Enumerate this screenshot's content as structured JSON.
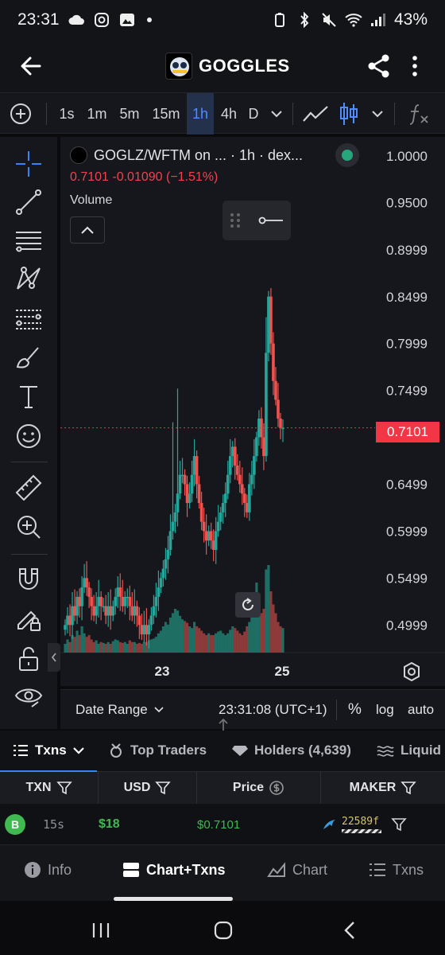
{
  "status_bar": {
    "time": "23:31",
    "battery": "43%",
    "signal_icon": "signal-bars-icon",
    "wifi_icon": "wifi-icon"
  },
  "header": {
    "title": "GOGGLES"
  },
  "toolbar": {
    "intervals": [
      "1s",
      "1m",
      "5m",
      "15m",
      "1h",
      "4h",
      "D"
    ],
    "active_interval": "1h"
  },
  "chart": {
    "legend_title": "GOGLZ/WFTM on ... · 1h · dex...",
    "legend_price": "0.7101  -0.01090 (−1.51%)",
    "volume_label": "Volume",
    "current_price_tag": "0.7101",
    "price_axis": [
      "1.0000",
      "0.9500",
      "0.8999",
      "0.8499",
      "0.7999",
      "0.7499",
      "0.6999",
      "0.6499",
      "0.5999",
      "0.5499",
      "0.4999"
    ],
    "time_axis": [
      "23",
      "25"
    ],
    "colors": {
      "up": "#26a69a",
      "down": "#ef5350",
      "price_tag": "#f23645",
      "accent": "#3b82f6"
    }
  },
  "chart_data": {
    "type": "candlestick",
    "title": "GOGLZ/WFTM on ... · 1h · dex...",
    "price_unit_ticks": [
      "0.4999",
      "0.5499",
      "0.5999",
      "0.6499",
      "0.6999",
      "0.7499",
      "0.7999",
      "0.8499",
      "0.8999",
      "0.9500",
      "1.0000"
    ],
    "ylim": [
      0.485,
      1.01
    ],
    "last_price": 0.7101,
    "change": -0.0109,
    "change_pct": -1.51,
    "closes": [
      0.5,
      0.51,
      0.5,
      0.52,
      0.51,
      0.53,
      0.52,
      0.54,
      0.55,
      0.54,
      0.53,
      0.52,
      0.51,
      0.52,
      0.53,
      0.52,
      0.52,
      0.51,
      0.52,
      0.51,
      0.52,
      0.53,
      0.54,
      0.53,
      0.52,
      0.53,
      0.53,
      0.52,
      0.51,
      0.52,
      0.51,
      0.5,
      0.49,
      0.5,
      0.49,
      0.5,
      0.51,
      0.52,
      0.53,
      0.54,
      0.55,
      0.56,
      0.57,
      0.58,
      0.6,
      0.61,
      0.62,
      0.64,
      0.66,
      0.66,
      0.65,
      0.63,
      0.64,
      0.66,
      0.68,
      0.65,
      0.63,
      0.61,
      0.6,
      0.59,
      0.6,
      0.59,
      0.58,
      0.6,
      0.61,
      0.62,
      0.63,
      0.64,
      0.66,
      0.68,
      0.69,
      0.67,
      0.66,
      0.65,
      0.64,
      0.63,
      0.62,
      0.65,
      0.66,
      0.68,
      0.7,
      0.72,
      0.7,
      0.68,
      0.79,
      0.85,
      0.8,
      0.76,
      0.74,
      0.72,
      0.71,
      0.7101
    ],
    "volume_relative": [
      0.1,
      0.15,
      0.12,
      0.2,
      0.18,
      0.25,
      0.2,
      0.3,
      0.22,
      0.18,
      0.2,
      0.15,
      0.12,
      0.14,
      0.1,
      0.12,
      0.11,
      0.1,
      0.12,
      0.1,
      0.13,
      0.15,
      0.14,
      0.12,
      0.11,
      0.12,
      0.1,
      0.14,
      0.12,
      0.12,
      0.1,
      0.11,
      0.1,
      0.12,
      0.12,
      0.14,
      0.15,
      0.16,
      0.18,
      0.22,
      0.25,
      0.3,
      0.35,
      0.32,
      0.4,
      0.45,
      0.5,
      0.48,
      0.42,
      0.38,
      0.36,
      0.34,
      0.3,
      0.28,
      0.35,
      0.3,
      0.28,
      0.25,
      0.22,
      0.2,
      0.22,
      0.2,
      0.2,
      0.22,
      0.24,
      0.25,
      0.22,
      0.2,
      0.22,
      0.26,
      0.3,
      0.28,
      0.25,
      0.22,
      0.2,
      0.24,
      0.3,
      0.35,
      0.42,
      0.6,
      0.8,
      0.55,
      0.45,
      0.5,
      0.95,
      1.0,
      0.7,
      0.55,
      0.45,
      0.35,
      0.3,
      0.28
    ]
  },
  "chart_bottom": {
    "date_range": "Date Range",
    "clock": "23:31:08 (UTC+1)",
    "percent": "%",
    "log": "log",
    "auto": "auto"
  },
  "tabs": {
    "txns": "Txns",
    "top_traders": "Top Traders",
    "holders": "Holders (4,639)",
    "liquidity": "Liquid"
  },
  "table": {
    "headers": {
      "txn": "TXN",
      "usd": "USD",
      "price": "Price",
      "maker": "MAKER"
    },
    "rows": [
      {
        "type": "B",
        "age": "15s",
        "usd": "$18",
        "price": "$0.7101",
        "maker": "22589f"
      }
    ]
  },
  "bottom_nav": {
    "info": "Info",
    "chart_txns": "Chart+Txns",
    "chart": "Chart",
    "txns": "Txns"
  }
}
